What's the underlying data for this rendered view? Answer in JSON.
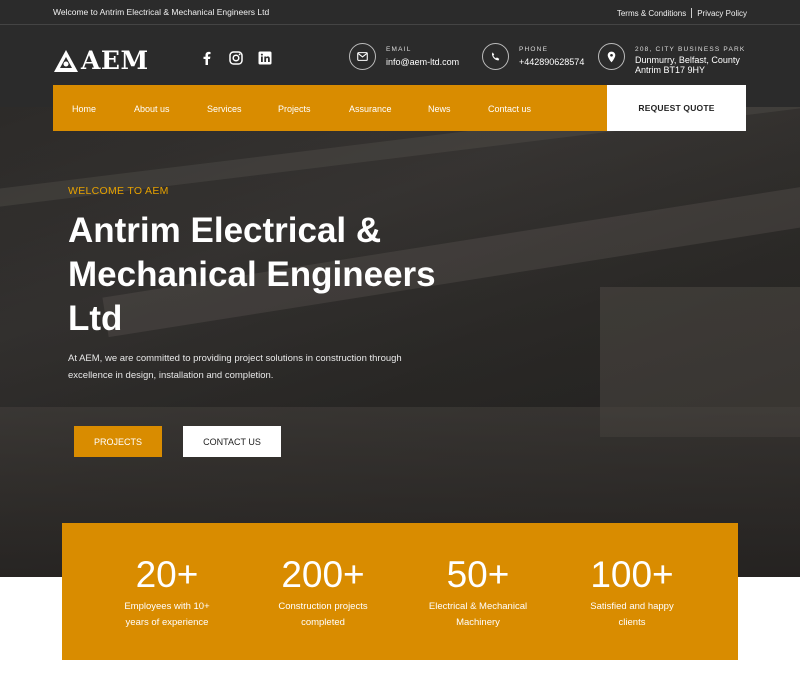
{
  "topbar": {
    "welcome": "Welcome to Antrim Electrical & Mechanical Engineers Ltd",
    "terms": "Terms & Conditions",
    "privacy": "Privacy Policy"
  },
  "brand": {
    "logo_text": "AEM"
  },
  "social": [
    "facebook-icon",
    "instagram-icon",
    "linkedin-icon"
  ],
  "contact": {
    "email_label": "EMAIL",
    "email_value": "info@aem-ltd.com",
    "phone_label": "PHONE",
    "phone_value": "+442890628574",
    "address_line1": "208, CITY BUSINESS PARK",
    "address_line2": "Dunmurry, Belfast, County",
    "address_line3": "Antrim BT17 9HY"
  },
  "nav": {
    "items": [
      "Home",
      "About us",
      "Services",
      "Projects",
      "Assurance",
      "News",
      "Contact us"
    ],
    "quote": "REQUEST QUOTE"
  },
  "hero": {
    "tag": "WELCOME TO AEM",
    "title": "Antrim Electrical & Mechanical Engineers Ltd",
    "description": "At AEM, we are committed to providing project solutions in construction through excellence in design, installation and completion.",
    "btn_projects": "PROJECTS",
    "btn_contact": "CONTACT US"
  },
  "stats": [
    {
      "number": "20+",
      "line1": "Employees with 10+",
      "line2": "years of experience"
    },
    {
      "number": "200+",
      "line1": "Construction projects",
      "line2": "completed"
    },
    {
      "number": "50+",
      "line1": "Electrical & Mechanical",
      "line2": "Machinery"
    },
    {
      "number": "100+",
      "line1": "Satisfied and happy",
      "line2": "clients"
    }
  ],
  "colors": {
    "accent": "#d98c00",
    "dark": "#2b2b2b",
    "tag": "#e6a100"
  }
}
